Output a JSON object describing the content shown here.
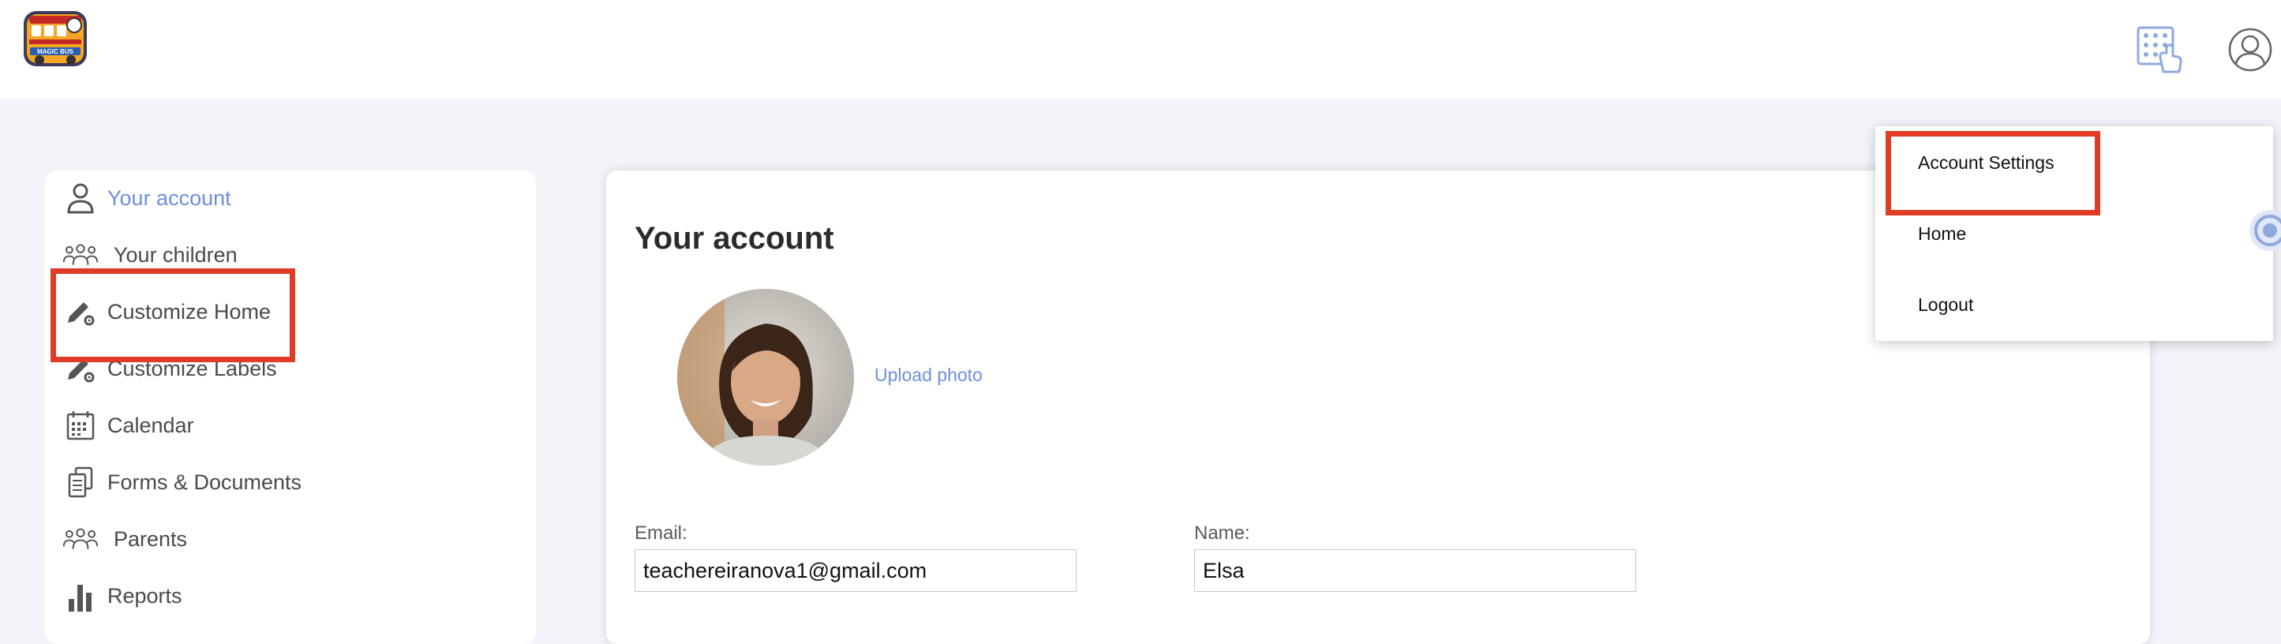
{
  "header": {
    "logo_name": "magic-bus-logo",
    "logo_text": "MAGIC BUS",
    "keypad_icon": "keypad-touch-icon",
    "profile_icon": "user-circle-icon"
  },
  "sidebar": {
    "items": [
      {
        "label": "Your account",
        "icon": "user-icon",
        "active": true
      },
      {
        "label": "Your children",
        "icon": "group-icon"
      },
      {
        "label": "Customize Home",
        "icon": "pencil-gear-icon"
      },
      {
        "label": "Customize Labels",
        "icon": "pencil-gear-icon"
      },
      {
        "label": "Calendar",
        "icon": "calendar-icon"
      },
      {
        "label": "Forms & Documents",
        "icon": "documents-icon"
      },
      {
        "label": "Parents",
        "icon": "group-icon"
      },
      {
        "label": "Reports",
        "icon": "bar-chart-icon"
      }
    ]
  },
  "main": {
    "title": "Your account",
    "upload_label": "Upload photo",
    "email_label": "Email:",
    "email_value": "teachereiranova1@gmail.com",
    "name_label": "Name:",
    "name_value": "Elsa"
  },
  "menu": {
    "items": [
      "Account Settings",
      "Home",
      "Logout"
    ]
  },
  "colors": {
    "accent": "#6f8fdb",
    "highlight": "#e03b25",
    "background": "#f3f4f9"
  }
}
